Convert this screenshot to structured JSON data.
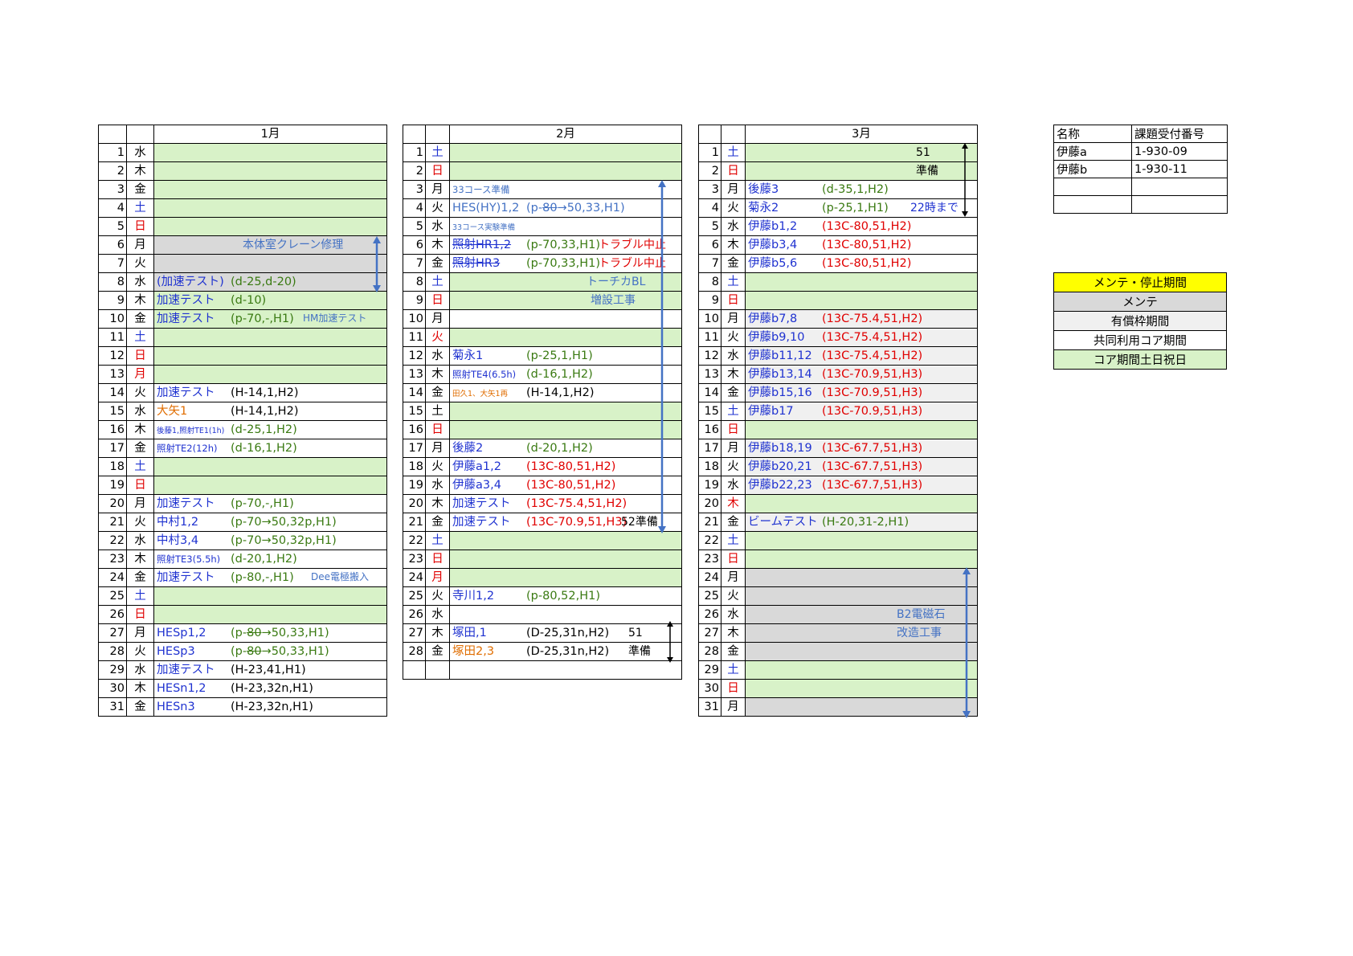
{
  "months": [
    {
      "title": "1月",
      "rows": [
        {
          "d": "1",
          "w": "水",
          "wc": "black",
          "bg": "green"
        },
        {
          "d": "2",
          "w": "木",
          "wc": "black",
          "bg": "green"
        },
        {
          "d": "3",
          "w": "金",
          "wc": "black",
          "bg": "green"
        },
        {
          "d": "4",
          "w": "土",
          "wc": "blue",
          "bg": "green"
        },
        {
          "d": "5",
          "w": "日",
          "wc": "red",
          "bg": "green"
        },
        {
          "d": "6",
          "w": "月",
          "wc": "black",
          "bg": "gray",
          "note": "本体室クレーン修理",
          "nc": "lblue",
          "np": 110
        },
        {
          "d": "7",
          "w": "火",
          "wc": "black",
          "bg": "gray"
        },
        {
          "d": "8",
          "w": "水",
          "wc": "black",
          "bg": "gray",
          "l": "(加速テスト)",
          "lc": "blue",
          "p": "(d-25,d-20)",
          "pc": "green-t",
          "pp": 95
        },
        {
          "d": "9",
          "w": "木",
          "wc": "black",
          "bg": "green",
          "l": "加速テスト",
          "lc": "blue",
          "p": "(d-10)",
          "pc": "green-t",
          "pp": 95
        },
        {
          "d": "10",
          "w": "金",
          "wc": "black",
          "bg": "green",
          "l": "加速テスト",
          "lc": "blue",
          "p": "(p-70,-,H1)",
          "pc": "green-t",
          "pp": 95,
          "note": "HM加速テスト",
          "nc": "lblue",
          "np": 185,
          "nsmall": true
        },
        {
          "d": "11",
          "w": "土",
          "wc": "blue",
          "bg": "green"
        },
        {
          "d": "12",
          "w": "日",
          "wc": "red",
          "bg": "green"
        },
        {
          "d": "13",
          "w": "月",
          "wc": "red",
          "bg": "green"
        },
        {
          "d": "14",
          "w": "火",
          "wc": "black",
          "bg": "",
          "l": "加速テスト",
          "lc": "blue",
          "p": "(H-14,1,H2)",
          "pc": "black",
          "pp": 95
        },
        {
          "d": "15",
          "w": "水",
          "wc": "black",
          "bg": "",
          "l": "大矢1",
          "lc": "orange",
          "p": "(H-14,1,H2)",
          "pc": "black",
          "pp": 95
        },
        {
          "d": "16",
          "w": "木",
          "wc": "black",
          "bg": "",
          "l": "後藤1,照射TE1(1h)",
          "lc": "blue",
          "lsmall": true,
          "p": "(d-25,1,H2)",
          "pc": "green-t",
          "pp": 95
        },
        {
          "d": "17",
          "w": "金",
          "wc": "black",
          "bg": "",
          "l": "照射TE2(12h)",
          "lc": "blue",
          "lsmall2": true,
          "p": "(d-16,1,H2)",
          "pc": "green-t",
          "pp": 95
        },
        {
          "d": "18",
          "w": "土",
          "wc": "blue",
          "bg": "green"
        },
        {
          "d": "19",
          "w": "日",
          "wc": "red",
          "bg": "green"
        },
        {
          "d": "20",
          "w": "月",
          "wc": "black",
          "bg": "",
          "l": "加速テスト",
          "lc": "blue",
          "p": "(p-70,-,H1)",
          "pc": "green-t",
          "pp": 95
        },
        {
          "d": "21",
          "w": "火",
          "wc": "black",
          "bg": "",
          "l": "中村1,2",
          "lc": "blue",
          "p": "(p-70→50,32p,H1)",
          "pc": "green-t",
          "pp": 95
        },
        {
          "d": "22",
          "w": "水",
          "wc": "black",
          "bg": "",
          "l": "中村3,4",
          "lc": "blue",
          "p": "(p-70→50,32p,H1)",
          "pc": "green-t",
          "pp": 95
        },
        {
          "d": "23",
          "w": "木",
          "wc": "black",
          "bg": "",
          "l": "照射TE3(5.5h)",
          "lc": "blue",
          "lsmall2": true,
          "p": "(d-20,1,H2)",
          "pc": "green-t",
          "pp": 95
        },
        {
          "d": "24",
          "w": "金",
          "wc": "black",
          "bg": "",
          "l": "加速テスト",
          "lc": "blue",
          "p": "(p-80,-,H1)",
          "pc": "green-t",
          "pp": 95,
          "note": "Dee電極搬入",
          "nc": "lblue",
          "np": 195,
          "nsmall": true
        },
        {
          "d": "25",
          "w": "土",
          "wc": "blue",
          "bg": "green"
        },
        {
          "d": "26",
          "w": "日",
          "wc": "red",
          "bg": "green"
        },
        {
          "d": "27",
          "w": "月",
          "wc": "black",
          "bg": "",
          "l": "HESp1,2",
          "lc": "blue",
          "p1": "(p-",
          "ps": "80",
          "p2": "→50,33,H1)",
          "pc": "green-t",
          "pp": 95
        },
        {
          "d": "28",
          "w": "火",
          "wc": "black",
          "bg": "",
          "l": "HESp3",
          "lc": "blue",
          "p1": "(p-",
          "ps": "80",
          "p2": "→50,33,H1)",
          "pc": "green-t",
          "pp": 95
        },
        {
          "d": "29",
          "w": "水",
          "wc": "black",
          "bg": "",
          "l": "加速テスト",
          "lc": "blue",
          "p": "(H-23,41,H1)",
          "pc": "black",
          "pp": 95
        },
        {
          "d": "30",
          "w": "木",
          "wc": "black",
          "bg": "",
          "l": "HESn1,2",
          "lc": "blue",
          "p": "(H-23,32n,H1)",
          "pc": "black",
          "pp": 95
        },
        {
          "d": "31",
          "w": "金",
          "wc": "black",
          "bg": "",
          "l": "HESn3",
          "lc": "blue",
          "p": "(H-23,32n,H1)",
          "pc": "black",
          "pp": 95
        }
      ]
    },
    {
      "title": "2月",
      "rows": [
        {
          "d": "1",
          "w": "土",
          "wc": "blue",
          "bg": "green"
        },
        {
          "d": "2",
          "w": "日",
          "wc": "red",
          "bg": "green"
        },
        {
          "d": "3",
          "w": "月",
          "wc": "black",
          "bg": "",
          "l": "33コース準備",
          "lc": "lblue",
          "lsmall2": true
        },
        {
          "d": "4",
          "w": "火",
          "wc": "black",
          "bg": "",
          "l": "HES(HY)1,2",
          "lc": "lblue",
          "p1": "(p-",
          "ps": "80",
          "p2": "→50,33,H1)",
          "pc": "lblue",
          "pp": 95
        },
        {
          "d": "5",
          "w": "水",
          "wc": "black",
          "bg": "",
          "l": "33コース実験準備",
          "lc": "lblue",
          "lsmall": true
        },
        {
          "d": "6",
          "w": "木",
          "wc": "black",
          "bg": "",
          "l": "照射HR1,2",
          "lc": "blue",
          "lstrike": true,
          "p": "(p-70,33,H1)",
          "pc": "green-t",
          "pp": 95,
          "note": "トラブル中止",
          "nc": "red",
          "np": 185
        },
        {
          "d": "7",
          "w": "金",
          "wc": "black",
          "bg": "",
          "l": "照射HR3",
          "lc": "blue",
          "lstrike": true,
          "p": "(p-70,33,H1)",
          "pc": "green-t",
          "pp": 95,
          "note": "トラブル中止",
          "nc": "red",
          "np": 185
        },
        {
          "d": "8",
          "w": "土",
          "wc": "blue",
          "bg": "green",
          "note": "トーチカBL",
          "nc": "lblue",
          "np": 170
        },
        {
          "d": "9",
          "w": "日",
          "wc": "red",
          "bg": "green",
          "note": "増設工事",
          "nc": "lblue",
          "np": 175
        },
        {
          "d": "10",
          "w": "月",
          "wc": "black",
          "bg": ""
        },
        {
          "d": "11",
          "w": "火",
          "wc": "red",
          "bg": "green"
        },
        {
          "d": "12",
          "w": "水",
          "wc": "black",
          "bg": "",
          "l": "菊永1",
          "lc": "blue",
          "p": "(p-25,1,H1)",
          "pc": "green-t",
          "pp": 95
        },
        {
          "d": "13",
          "w": "木",
          "wc": "black",
          "bg": "",
          "l": "照射TE4(6.5h)",
          "lc": "blue",
          "lsmall2": true,
          "p": "(d-16,1,H2)",
          "pc": "green-t",
          "pp": 95
        },
        {
          "d": "14",
          "w": "金",
          "wc": "black",
          "bg": "",
          "l": "田久1、大矢1再",
          "lc": "orange",
          "lsmall": true,
          "p": "(H-14,1,H2)",
          "pc": "black",
          "pp": 95
        },
        {
          "d": "15",
          "w": "土",
          "wc": "black",
          "bg": "green"
        },
        {
          "d": "16",
          "w": "日",
          "wc": "red",
          "bg": "green"
        },
        {
          "d": "17",
          "w": "月",
          "wc": "black",
          "bg": "",
          "l": "後藤2",
          "lc": "blue",
          "p": "(d-20,1,H2)",
          "pc": "green-t",
          "pp": 95
        },
        {
          "d": "18",
          "w": "火",
          "wc": "black",
          "bg": "",
          "l": "伊藤a1,2",
          "lc": "blue",
          "p": "(13C-80,51,H2)",
          "pc": "red",
          "pp": 95
        },
        {
          "d": "19",
          "w": "水",
          "wc": "black",
          "bg": "",
          "l": "伊藤a3,4",
          "lc": "blue",
          "p": "(13C-80,51,H2)",
          "pc": "red",
          "pp": 95
        },
        {
          "d": "20",
          "w": "木",
          "wc": "black",
          "bg": "",
          "l": "加速テスト",
          "lc": "blue",
          "p": "(13C-75.4,51,H2)",
          "pc": "red",
          "pp": 95
        },
        {
          "d": "21",
          "w": "金",
          "wc": "black",
          "bg": "",
          "l": "加速テスト",
          "lc": "blue",
          "p": "(13C-70.9,51,H3)",
          "pc": "red",
          "pp": 95,
          "note": "52準備",
          "nc": "black",
          "np": 213
        },
        {
          "d": "22",
          "w": "土",
          "wc": "blue",
          "bg": "green"
        },
        {
          "d": "23",
          "w": "日",
          "wc": "red",
          "bg": "green"
        },
        {
          "d": "24",
          "w": "月",
          "wc": "red",
          "bg": "green"
        },
        {
          "d": "25",
          "w": "火",
          "wc": "black",
          "bg": "",
          "l": "寺川1,2",
          "lc": "blue",
          "p": "(p-80,52,H1)",
          "pc": "green-t",
          "pp": 95
        },
        {
          "d": "26",
          "w": "水",
          "wc": "black",
          "bg": ""
        },
        {
          "d": "27",
          "w": "木",
          "wc": "black",
          "bg": "",
          "l": "塚田,1",
          "lc": "blue",
          "p": "(D-25,31n,H2)",
          "pc": "black",
          "pp": 95,
          "note": "51",
          "nc": "black",
          "np": 222
        },
        {
          "d": "28",
          "w": "金",
          "wc": "black",
          "bg": "",
          "l": "塚田2,3",
          "lc": "orange",
          "p": "(D-25,31n,H2)",
          "pc": "black",
          "pp": 95,
          "note": "準備",
          "nc": "black",
          "np": 222
        },
        {
          "d": "",
          "w": "",
          "wc": "black",
          "bg": ""
        }
      ]
    },
    {
      "title": "3月",
      "rows": [
        {
          "d": "1",
          "w": "土",
          "wc": "blue",
          "bg": "green",
          "note": "51",
          "nc": "black",
          "np": 212
        },
        {
          "d": "2",
          "w": "日",
          "wc": "red",
          "bg": "green",
          "note": "準備",
          "nc": "black",
          "np": 212
        },
        {
          "d": "3",
          "w": "月",
          "wc": "black",
          "bg": "",
          "l": "後藤3",
          "lc": "blue",
          "p": "(d-35,1,H2)",
          "pc": "green-t",
          "pp": 95
        },
        {
          "d": "4",
          "w": "火",
          "wc": "black",
          "bg": "",
          "l": "菊永2",
          "lc": "blue",
          "p": "(p-25,1,H1)",
          "pc": "green-t",
          "pp": 95,
          "note": "22時まで",
          "nc": "blue",
          "np": 205
        },
        {
          "d": "5",
          "w": "水",
          "wc": "black",
          "bg": "",
          "l": "伊藤b1,2",
          "lc": "blue",
          "p": "(13C-80,51,H2)",
          "pc": "red",
          "pp": 95
        },
        {
          "d": "6",
          "w": "木",
          "wc": "black",
          "bg": "",
          "l": "伊藤b3,4",
          "lc": "blue",
          "p": "(13C-80,51,H2)",
          "pc": "red",
          "pp": 95
        },
        {
          "d": "7",
          "w": "金",
          "wc": "black",
          "bg": "",
          "l": "伊藤b5,6",
          "lc": "blue",
          "p": "(13C-80,51,H2)",
          "pc": "red",
          "pp": 95
        },
        {
          "d": "8",
          "w": "土",
          "wc": "blue",
          "bg": "green"
        },
        {
          "d": "9",
          "w": "日",
          "wc": "red",
          "bg": "green"
        },
        {
          "d": "10",
          "w": "月",
          "wc": "black",
          "bg": "lgray",
          "l": "伊藤b7,8",
          "lc": "blue",
          "p": "(13C-75.4,51,H2)",
          "pc": "red",
          "pp": 95
        },
        {
          "d": "11",
          "w": "火",
          "wc": "black",
          "bg": "lgray",
          "l": "伊藤b9,10",
          "lc": "blue",
          "p": "(13C-75.4,51,H2)",
          "pc": "red",
          "pp": 95
        },
        {
          "d": "12",
          "w": "水",
          "wc": "black",
          "bg": "lgray",
          "l": "伊藤b11,12",
          "lc": "blue",
          "p": "(13C-75.4,51,H2)",
          "pc": "red",
          "pp": 95
        },
        {
          "d": "13",
          "w": "木",
          "wc": "black",
          "bg": "lgray",
          "l": "伊藤b13,14",
          "lc": "blue",
          "p": "(13C-70.9,51,H3)",
          "pc": "red",
          "pp": 95
        },
        {
          "d": "14",
          "w": "金",
          "wc": "black",
          "bg": "lgray",
          "l": "伊藤b15,16",
          "lc": "blue",
          "p": "(13C-70.9,51,H3)",
          "pc": "red",
          "pp": 95
        },
        {
          "d": "15",
          "w": "土",
          "wc": "blue",
          "bg": "lgray",
          "l": "伊藤b17",
          "lc": "blue",
          "p": "(13C-70.9,51,H3)",
          "pc": "red",
          "pp": 95
        },
        {
          "d": "16",
          "w": "日",
          "wc": "red",
          "bg": "green"
        },
        {
          "d": "17",
          "w": "月",
          "wc": "black",
          "bg": "lgray",
          "l": "伊藤b18,19",
          "lc": "blue",
          "p": "(13C-67.7,51,H3)",
          "pc": "red",
          "pp": 95
        },
        {
          "d": "18",
          "w": "火",
          "wc": "black",
          "bg": "lgray",
          "l": "伊藤b20,21",
          "lc": "blue",
          "p": "(13C-67.7,51,H3)",
          "pc": "red",
          "pp": 95
        },
        {
          "d": "19",
          "w": "水",
          "wc": "black",
          "bg": "lgray",
          "l": "伊藤b22,23",
          "lc": "blue",
          "p": "(13C-67.7,51,H3)",
          "pc": "red",
          "pp": 95
        },
        {
          "d": "20",
          "w": "木",
          "wc": "red",
          "bg": "green"
        },
        {
          "d": "21",
          "w": "金",
          "wc": "black",
          "bg": "lgray",
          "l": "ビームテスト",
          "lc": "blue",
          "p": "(H-20,31-2,H1)",
          "pc": "green-t",
          "pp": 95
        },
        {
          "d": "22",
          "w": "土",
          "wc": "blue",
          "bg": "green"
        },
        {
          "d": "23",
          "w": "日",
          "wc": "red",
          "bg": "green"
        },
        {
          "d": "24",
          "w": "月",
          "wc": "black",
          "bg": "gray"
        },
        {
          "d": "25",
          "w": "火",
          "wc": "black",
          "bg": "gray"
        },
        {
          "d": "26",
          "w": "水",
          "wc": "black",
          "bg": "gray",
          "note": "B2電磁石",
          "nc": "lblue",
          "np": 188
        },
        {
          "d": "27",
          "w": "木",
          "wc": "black",
          "bg": "gray",
          "note": "改造工事",
          "nc": "lblue",
          "np": 188
        },
        {
          "d": "28",
          "w": "金",
          "wc": "black",
          "bg": "gray"
        },
        {
          "d": "29",
          "w": "土",
          "wc": "blue",
          "bg": "green"
        },
        {
          "d": "30",
          "w": "日",
          "wc": "red",
          "bg": "green"
        },
        {
          "d": "31",
          "w": "月",
          "wc": "black",
          "bg": "gray"
        }
      ]
    }
  ],
  "ids_table": {
    "header": [
      "名称",
      "課題受付番号"
    ],
    "rows": [
      [
        "伊藤a",
        "1-930-09"
      ],
      [
        "伊藤b",
        "1-930-11"
      ],
      [
        "",
        ""
      ],
      [
        "",
        ""
      ]
    ]
  },
  "legend": [
    {
      "label": "メンテ・停止期間",
      "color": "#ffff00"
    },
    {
      "label": "メンテ",
      "color": "#d9d9d9"
    },
    {
      "label": "有償枠期間",
      "color": "#f0f0f0"
    },
    {
      "label": "共同利用コア期間",
      "color": "#ffffff"
    },
    {
      "label": "コア期間土日祝日",
      "color": "#d8f2c8"
    }
  ],
  "colors": {
    "weekday_blue": "#1f32d0",
    "holiday_red": "#e00000",
    "arrow_blue": "#4472c4"
  }
}
